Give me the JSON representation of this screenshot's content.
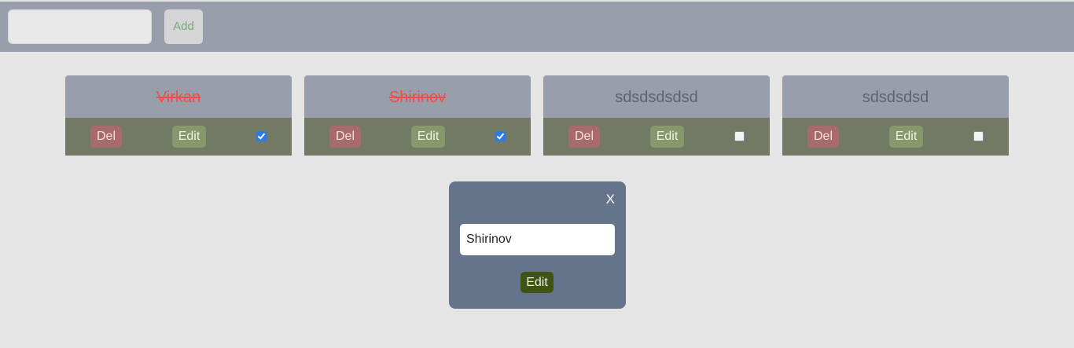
{
  "topbar": {
    "input_value": "",
    "input_placeholder": "",
    "add_label": "Add"
  },
  "cards": [
    {
      "title": "Virkan",
      "done": true,
      "del_label": "Del",
      "edit_label": "Edit"
    },
    {
      "title": "Shirinov",
      "done": true,
      "del_label": "Del",
      "edit_label": "Edit"
    },
    {
      "title": "sdsdsdsdsd",
      "done": false,
      "del_label": "Del",
      "edit_label": "Edit"
    },
    {
      "title": "sdsdsdsd",
      "done": false,
      "del_label": "Del",
      "edit_label": "Edit"
    }
  ],
  "modal": {
    "close_label": "X",
    "input_value": "Shirinov",
    "edit_label": "Edit"
  },
  "colors": {
    "bar": "#989fab",
    "done_title": "#f24b4b",
    "card_footer": "#737a63",
    "del_button": "#a76b6b",
    "edit_button": "#89976c",
    "modal_bg": "#66748b",
    "modal_edit_button": "#3f5413"
  }
}
